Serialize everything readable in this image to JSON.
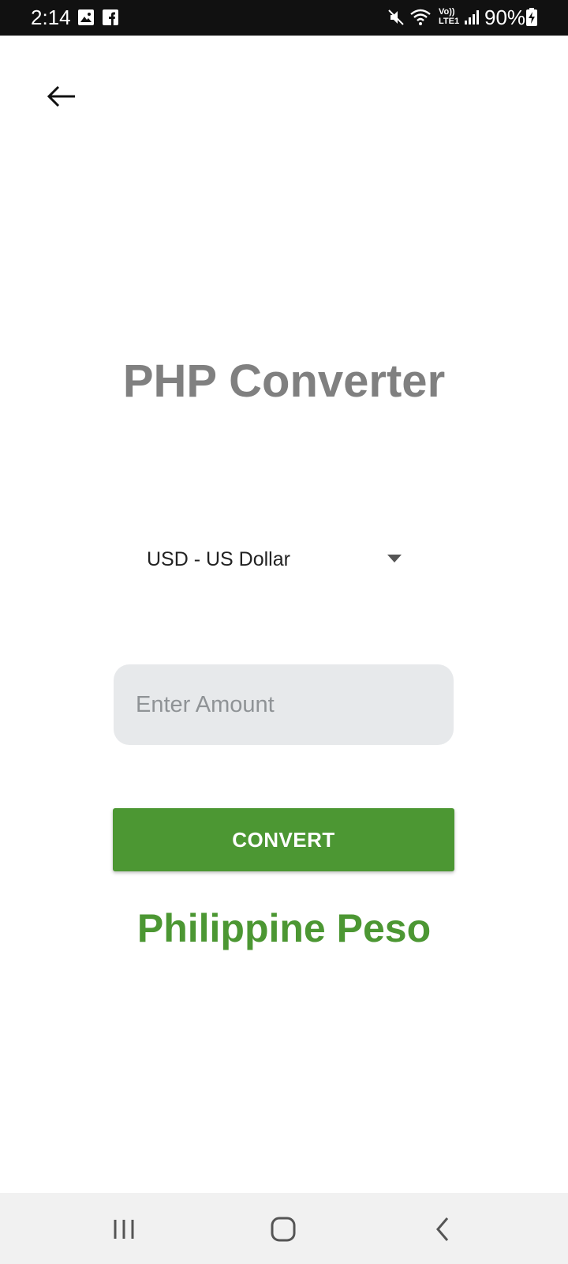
{
  "status_bar": {
    "time": "2:14",
    "battery": "90%",
    "icons": [
      "gallery-icon",
      "facebook-icon",
      "mute-icon",
      "wifi-icon",
      "volte-lte-icon",
      "signal-icon",
      "battery-charging-icon"
    ],
    "volte_label": "Vo)) LTE1"
  },
  "header": {
    "back_icon": "back-arrow-icon"
  },
  "main": {
    "title": "PHP Converter",
    "currency_select": {
      "selected": "USD - US Dollar"
    },
    "amount_input": {
      "value": "",
      "placeholder": "Enter Amount"
    },
    "convert_label": "CONVERT",
    "result_label": "Philippine Peso"
  },
  "nav_bar": {
    "icons": [
      "recent-apps-icon",
      "home-icon",
      "nav-back-icon"
    ]
  },
  "colors": {
    "accent": "#4c9733",
    "title": "#808080",
    "input_bg": "#e7e9eb",
    "status_bar": "#111111",
    "nav_bar": "#f1f1f1"
  }
}
